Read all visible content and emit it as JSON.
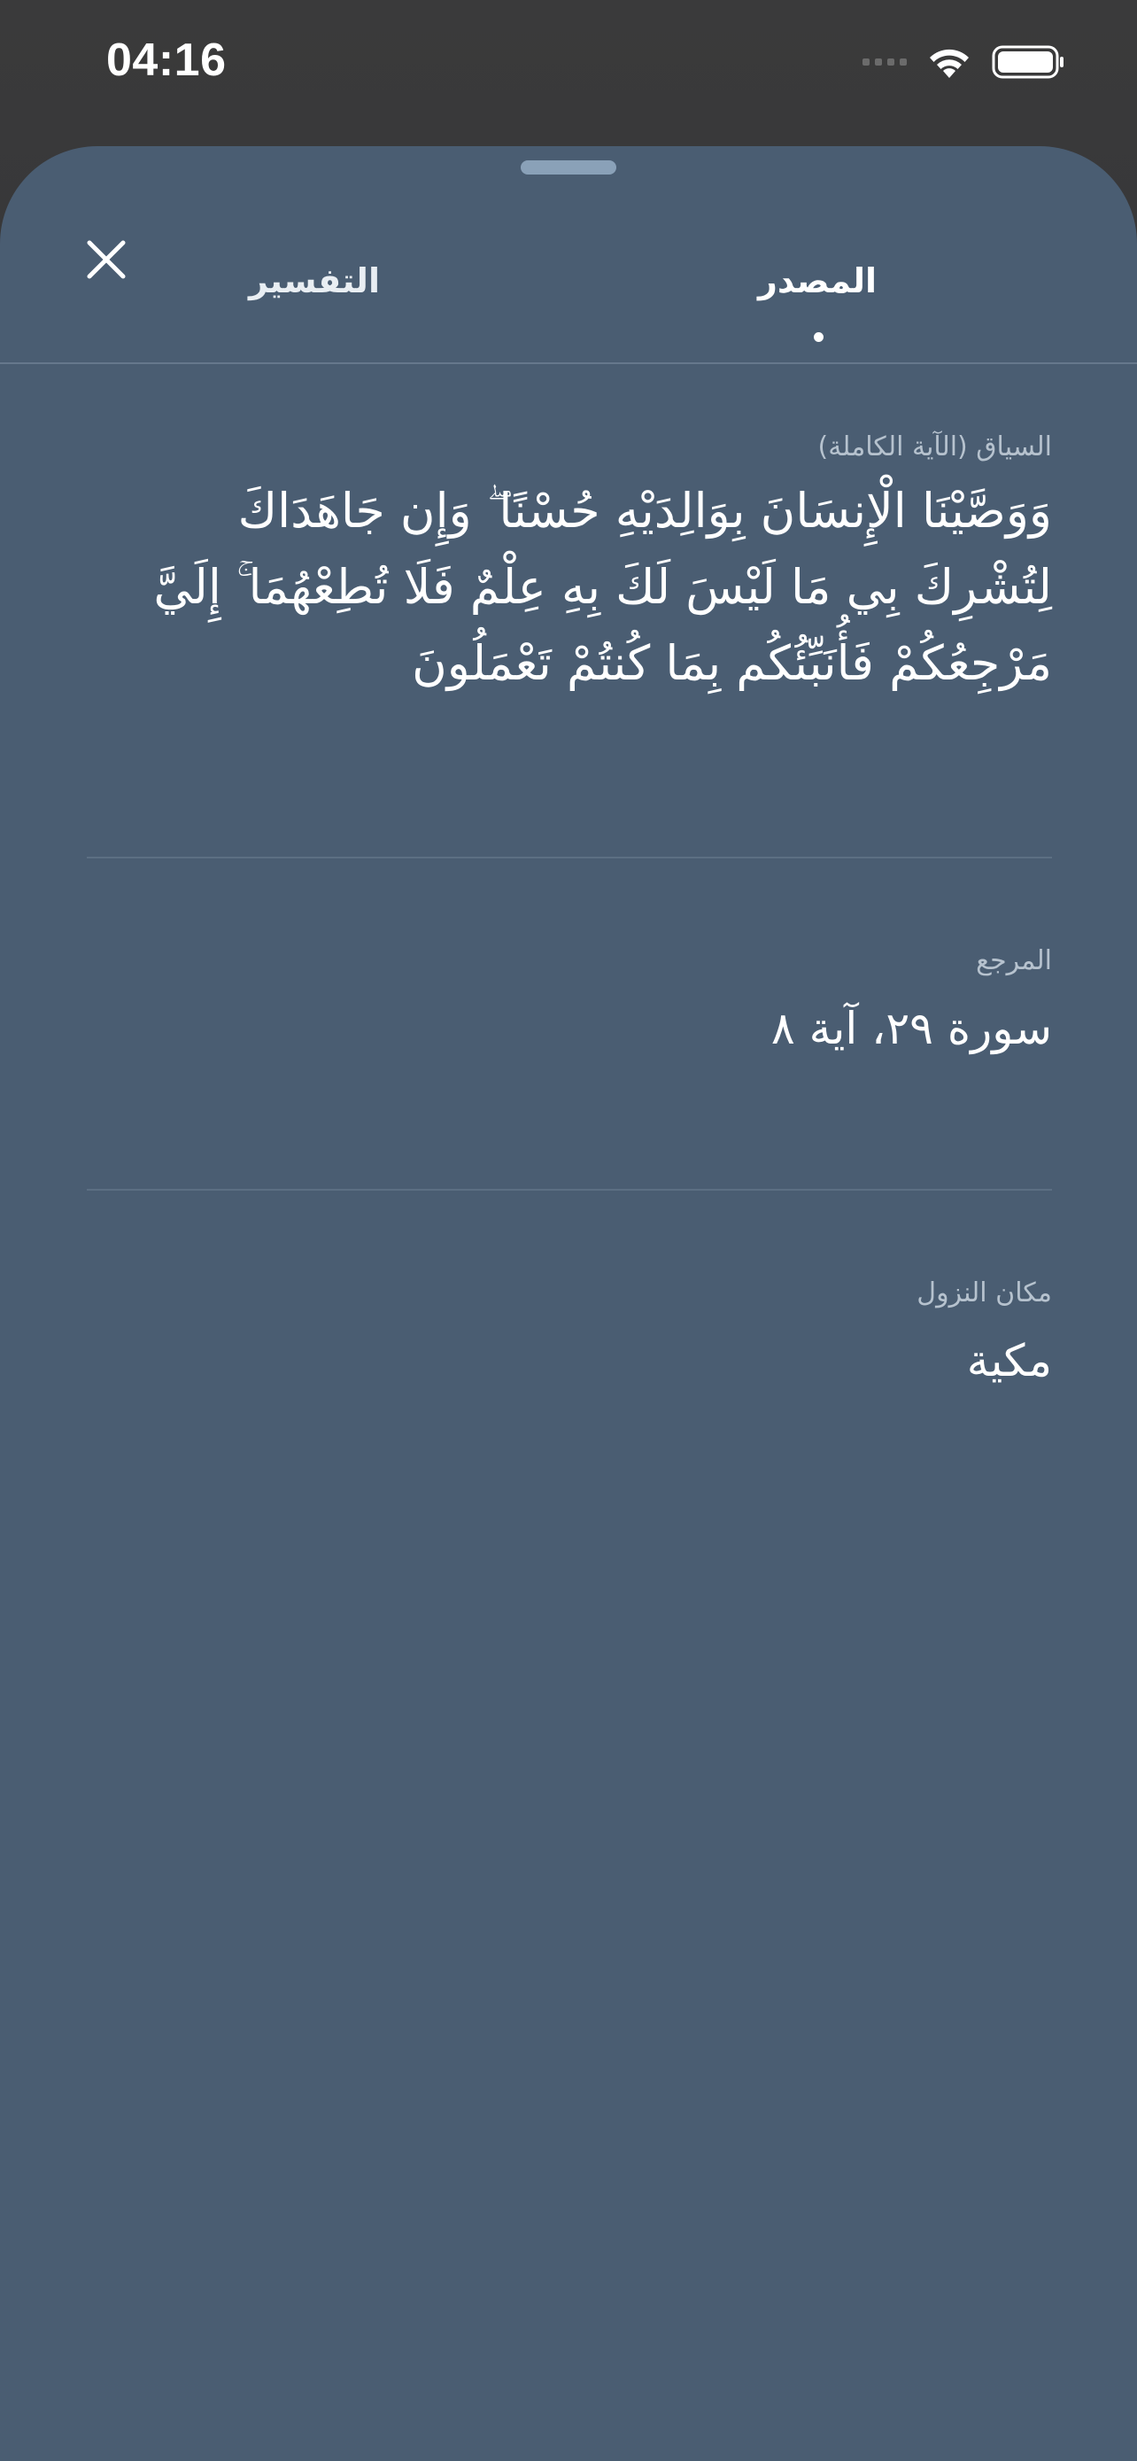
{
  "status_bar": {
    "time": "04:16",
    "icons": [
      "cellular-signal-icon",
      "wifi-icon",
      "battery-icon"
    ]
  },
  "sheet": {
    "close_icon": "close-icon",
    "tabs": [
      {
        "label": "المصدر",
        "selected": true
      },
      {
        "label": "التفسير",
        "selected": false
      }
    ]
  },
  "context": {
    "label": "السياق (الآية الكاملة)",
    "verse": "وَوَصَّيْنَا الْإِنسَانَ بِوَالِدَيْهِ حُسْنًا ۖ وَإِن جَاهَدَاكَ لِتُشْرِكَ بِي مَا لَيْسَ لَكَ بِهِ عِلْمٌ فَلَا تُطِعْهُمَا ۚ إِلَيَّ مَرْجِعُكُمْ فَأُنَبِّئُكُم بِمَا كُنتُمْ تَعْمَلُونَ"
  },
  "reference": {
    "label": "المرجع",
    "value": "سورة ٢٩، آية ٨"
  },
  "revelation": {
    "label": "مكان النزول",
    "value": "مكية"
  },
  "colors": {
    "sheet_background": "#4a5d72",
    "label_text": "#b6c2ce",
    "primary_text": "#ffffff",
    "divider": "#5c6f83"
  }
}
